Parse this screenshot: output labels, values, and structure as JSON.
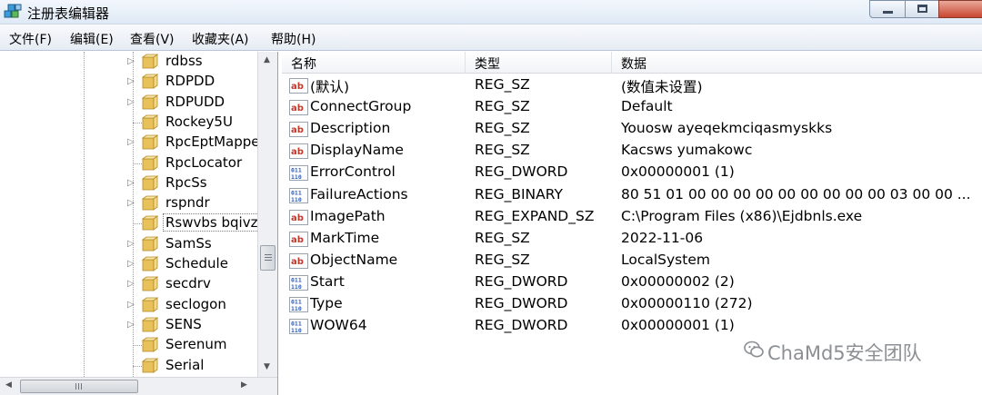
{
  "window": {
    "title": "注册表编辑器",
    "icon": "registry-editor-icon"
  },
  "menu": [
    "文件(F)",
    "编辑(E)",
    "查看(V)",
    "收藏夹(A)",
    "帮助(H)"
  ],
  "tree": {
    "items": [
      {
        "label": "rdbss",
        "expandable": true
      },
      {
        "label": "RDPDD",
        "expandable": true
      },
      {
        "label": "RDPUDD",
        "expandable": true
      },
      {
        "label": "Rockey5U",
        "expandable": false
      },
      {
        "label": "RpcEptMapper",
        "expandable": true
      },
      {
        "label": "RpcLocator",
        "expandable": false
      },
      {
        "label": "RpcSs",
        "expandable": true
      },
      {
        "label": "rspndr",
        "expandable": true
      },
      {
        "label": "Rswvbs bqivzbrzfh",
        "expandable": false,
        "selected": true
      },
      {
        "label": "SamSs",
        "expandable": true
      },
      {
        "label": "Schedule",
        "expandable": true
      },
      {
        "label": "secdrv",
        "expandable": true
      },
      {
        "label": "seclogon",
        "expandable": true
      },
      {
        "label": "SENS",
        "expandable": true
      },
      {
        "label": "Serenum",
        "expandable": false
      },
      {
        "label": "Serial",
        "expandable": false
      }
    ]
  },
  "list": {
    "columns": [
      "名称",
      "类型",
      "数据"
    ],
    "rows": [
      {
        "name": "(默认)",
        "type": "REG_SZ",
        "data": "(数值未设置)",
        "kind": "string"
      },
      {
        "name": "ConnectGroup",
        "type": "REG_SZ",
        "data": "Default",
        "kind": "string"
      },
      {
        "name": "Description",
        "type": "REG_SZ",
        "data": "Youosw ayeqekmciqasmyskks",
        "kind": "string"
      },
      {
        "name": "DisplayName",
        "type": "REG_SZ",
        "data": "Kacsws yumakowc",
        "kind": "string"
      },
      {
        "name": "ErrorControl",
        "type": "REG_DWORD",
        "data": "0x00000001 (1)",
        "kind": "binary"
      },
      {
        "name": "FailureActions",
        "type": "REG_BINARY",
        "data": "80 51 01 00 00 00 00 00 00 00 00 00 03 00 00 ...",
        "kind": "binary"
      },
      {
        "name": "ImagePath",
        "type": "REG_EXPAND_SZ",
        "data": "C:\\Program Files (x86)\\Ejdbnls.exe",
        "kind": "string"
      },
      {
        "name": "MarkTime",
        "type": "REG_SZ",
        "data": "2022-11-06",
        "kind": "string"
      },
      {
        "name": "ObjectName",
        "type": "REG_SZ",
        "data": "LocalSystem",
        "kind": "string"
      },
      {
        "name": "Start",
        "type": "REG_DWORD",
        "data": "0x00000002 (2)",
        "kind": "binary"
      },
      {
        "name": "Type",
        "type": "REG_DWORD",
        "data": "0x00000110 (272)",
        "kind": "binary"
      },
      {
        "name": "WOW64",
        "type": "REG_DWORD",
        "data": "0x00000001 (1)",
        "kind": "binary"
      }
    ]
  },
  "watermark": {
    "text": "ChaMd5安全团队",
    "icon": "wechat-icon"
  },
  "colors": {
    "string_icon": "#c0392b",
    "binary_icon": "#2a5bb8",
    "folder": "#e8c15a"
  }
}
